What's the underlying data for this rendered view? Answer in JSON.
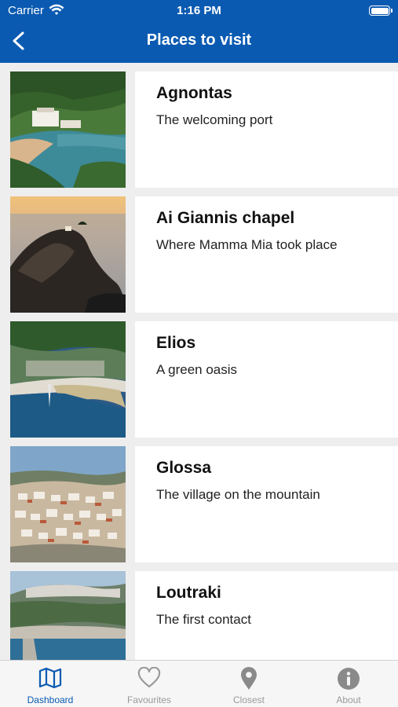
{
  "status_bar": {
    "carrier": "Carrier",
    "time": "1:16 PM"
  },
  "nav": {
    "title": "Places to visit",
    "back_icon": "chevron-left-icon"
  },
  "places": [
    {
      "title": "Agnontas",
      "subtitle": "The welcoming port"
    },
    {
      "title": "Ai Giannis chapel",
      "subtitle": "Where Mamma Mia took place"
    },
    {
      "title": "Elios",
      "subtitle": "A green oasis"
    },
    {
      "title": "Glossa",
      "subtitle": "The village on the mountain"
    },
    {
      "title": "Loutraki",
      "subtitle": "The first contact"
    }
  ],
  "tabs": [
    {
      "label": "Dashboard",
      "icon": "map-icon",
      "active": true
    },
    {
      "label": "Favourites",
      "icon": "heart-icon",
      "active": false
    },
    {
      "label": "Closest",
      "icon": "location-pin-icon",
      "active": false
    },
    {
      "label": "About",
      "icon": "info-icon",
      "active": false
    }
  ],
  "colors": {
    "primary": "#0a5ab1",
    "tab_inactive": "#999999",
    "background": "#eeeeee"
  }
}
